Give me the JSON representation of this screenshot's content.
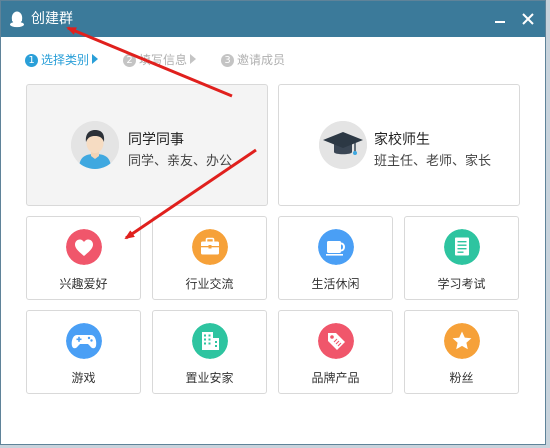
{
  "window": {
    "title": "创建群",
    "minimize_symbol": "minimize-icon",
    "close_symbol": "close-icon"
  },
  "steps": [
    {
      "num": "1",
      "label": "选择类别",
      "state": "active"
    },
    {
      "num": "2",
      "label": "填写信息",
      "state": "inactive"
    },
    {
      "num": "3",
      "label": "邀请成员",
      "state": "inactive"
    }
  ],
  "big_cards": [
    {
      "title": "同学同事",
      "subtitle": "同学、亲友、办公",
      "icon": "person-avatar-icon",
      "selected": true
    },
    {
      "title": "家校师生",
      "subtitle": "班主任、老师、家长",
      "icon": "graduation-cap-icon",
      "selected": false
    }
  ],
  "categories": [
    {
      "label": "兴趣爱好",
      "icon": "heart-icon",
      "color": "#f0566b"
    },
    {
      "label": "行业交流",
      "icon": "briefcase-icon",
      "color": "#f6a139"
    },
    {
      "label": "生活休闲",
      "icon": "coffee-cup-icon",
      "color": "#4a9ff5"
    },
    {
      "label": "学习考试",
      "icon": "document-icon",
      "color": "#2ec4a0"
    },
    {
      "label": "游戏",
      "icon": "gamepad-icon",
      "color": "#4a9ff5"
    },
    {
      "label": "置业安家",
      "icon": "building-icon",
      "color": "#2ec4a0"
    },
    {
      "label": "品牌产品",
      "icon": "tag-icon",
      "color": "#f0566b"
    },
    {
      "label": "粉丝",
      "icon": "star-icon",
      "color": "#f6a139"
    }
  ],
  "colors": {
    "titlebar": "#3b7a9a",
    "active_step": "#2a9fd8",
    "annotation_arrow": "#e0201d"
  }
}
